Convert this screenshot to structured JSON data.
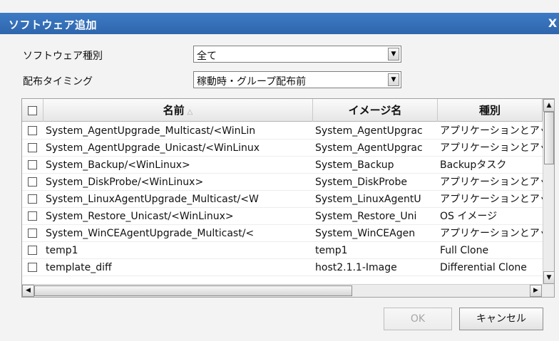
{
  "dialog": {
    "title": "ソフトウェア追加",
    "close_label": "X"
  },
  "filters": {
    "software_type_label": "ソフトウェア種別",
    "software_type_value": "全て",
    "timing_label": "配布タイミング",
    "timing_value": "稼動時・グループ配布前"
  },
  "table": {
    "columns": [
      "名前",
      "イメージ名",
      "種別"
    ],
    "sort_indicator": "△",
    "rows": [
      [
        "System_AgentUpgrade_Multicast/<WinLin",
        "System_AgentUpgrac",
        "アプリケーションとアッ"
      ],
      [
        "System_AgentUpgrade_Unicast/<WinLinux",
        "System_AgentUpgrac",
        "アプリケーションとアッ"
      ],
      [
        "System_Backup/<WinLinux>",
        "System_Backup",
        "Backupタスク"
      ],
      [
        "System_DiskProbe/<WinLinux>",
        "System_DiskProbe",
        "アプリケーションとアッ"
      ],
      [
        "System_LinuxAgentUpgrade_Multicast/<W",
        "System_LinuxAgentU",
        "アプリケーションとアッ"
      ],
      [
        "System_Restore_Unicast/<WinLinux>",
        "System_Restore_Uni",
        "OS イメージ"
      ],
      [
        "System_WinCEAgentUpgrade_Multicast/<",
        "System_WinCEAgen",
        "アプリケーションとアッ"
      ],
      [
        "temp1",
        "temp1",
        "Full Clone"
      ],
      [
        "template_diff",
        "host2.1.1-Image",
        "Differential Clone"
      ]
    ]
  },
  "buttons": {
    "ok": "OK",
    "cancel": "キャンセル"
  }
}
